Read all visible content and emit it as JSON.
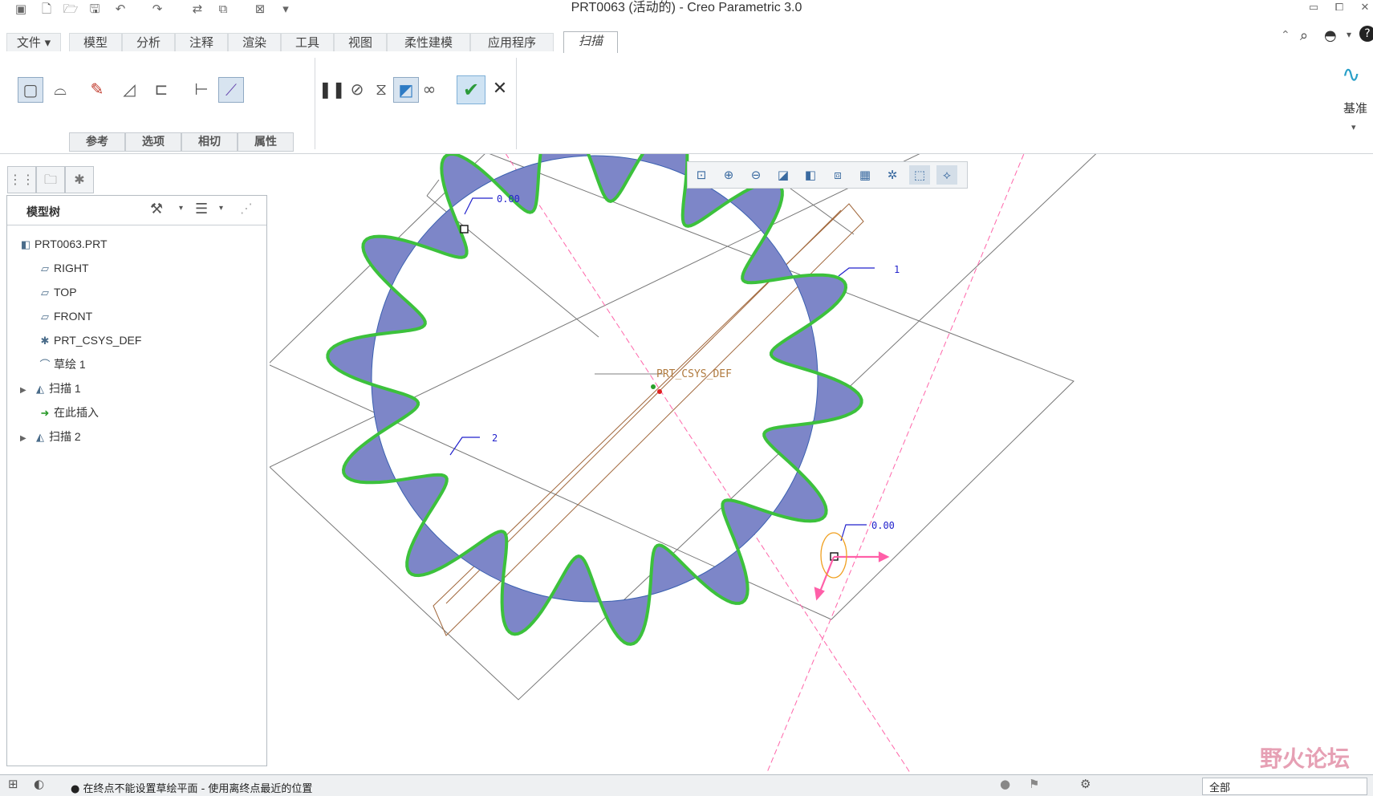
{
  "window": {
    "title": "PRT0063 (活动的) - Creo Parametric 3.0",
    "controls": [
      "minimize-icon",
      "restore-icon",
      "close-icon"
    ]
  },
  "quick_access": [
    "app-icon",
    "new-icon",
    "open-icon",
    "save-icon",
    "undo-icon",
    "redo-icon",
    "regenerate-icon",
    "windows-icon",
    "close-window-icon",
    "customize-icon"
  ],
  "tabs": [
    {
      "label": "文件 ▾"
    },
    {
      "label": "模型"
    },
    {
      "label": "分析"
    },
    {
      "label": "注释"
    },
    {
      "label": "渲染"
    },
    {
      "label": "工具"
    },
    {
      "label": "视图"
    },
    {
      "label": "柔性建模"
    },
    {
      "label": "应用程序"
    },
    {
      "label": "扫描"
    }
  ],
  "ribbon": {
    "subtabs": [
      "参考",
      "选项",
      "相切",
      "属性"
    ],
    "right_group": "基准"
  },
  "model_tree": {
    "title": "模型树",
    "items": [
      {
        "label": "PRT0063.PRT",
        "icon": "part-icon"
      },
      {
        "label": "RIGHT",
        "icon": "datum-plane-icon"
      },
      {
        "label": "TOP",
        "icon": "datum-plane-icon"
      },
      {
        "label": "FRONT",
        "icon": "datum-plane-icon"
      },
      {
        "label": "PRT_CSYS_DEF",
        "icon": "csys-icon"
      },
      {
        "label": "草绘 1",
        "icon": "sketch-icon"
      },
      {
        "label": "扫描 1",
        "icon": "sweep-icon"
      },
      {
        "label": "在此插入",
        "icon": "insert-here-icon"
      },
      {
        "label": "扫描 2",
        "icon": "sweep-icon"
      }
    ]
  },
  "viewport": {
    "csys_label": "PRT_CSYS_DEF",
    "dim_top": "0.00",
    "dim_bottom": "0.00",
    "traj_1": "1",
    "traj_2": "2"
  },
  "status": {
    "message": "● 在终点不能设置草绘平面 - 使用离终点最近的位置",
    "filter": "全部"
  },
  "watermark": "野火论坛",
  "colors": {
    "accent": "#3a76b8",
    "sweep_fill": "#7d86c8",
    "edge_highlight": "#3cc13c",
    "ok_button": "#3fa844"
  }
}
